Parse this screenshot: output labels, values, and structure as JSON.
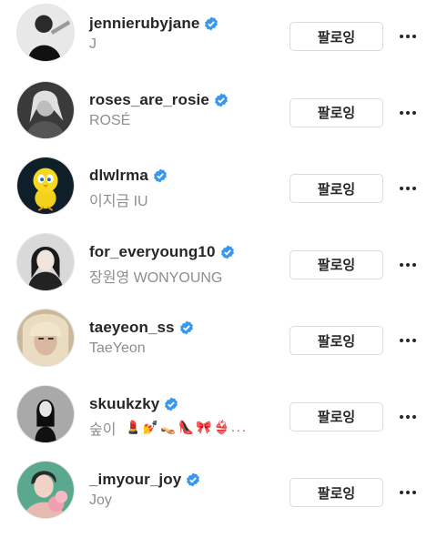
{
  "follow_list": [
    {
      "username": "jennierubyjane",
      "full_name": "J",
      "verified": true,
      "button_label": "팔로잉"
    },
    {
      "username": "roses_are_rosie",
      "full_name": "ROSÉ",
      "verified": true,
      "button_label": "팔로잉"
    },
    {
      "username": "dlwlrma",
      "full_name": "이지금 IU",
      "verified": true,
      "button_label": "팔로잉"
    },
    {
      "username": "for_everyoung10",
      "full_name": "장원영 WONYOUNG",
      "verified": true,
      "button_label": "팔로잉"
    },
    {
      "username": "taeyeon_ss",
      "full_name": "TaeYeon",
      "verified": true,
      "button_label": "팔로잉"
    },
    {
      "username": "skuukzky",
      "full_name": "숲이",
      "full_name_emojis": "💄💅👡👠🎀👙...",
      "verified": true,
      "button_label": "팔로잉"
    },
    {
      "username": "_imyour_joy",
      "full_name": "Joy",
      "verified": true,
      "button_label": "팔로잉"
    }
  ],
  "colors": {
    "verified_badge": "#3897f0",
    "secondary_text": "#8e8e8e",
    "button_border": "#dbdbdb"
  }
}
